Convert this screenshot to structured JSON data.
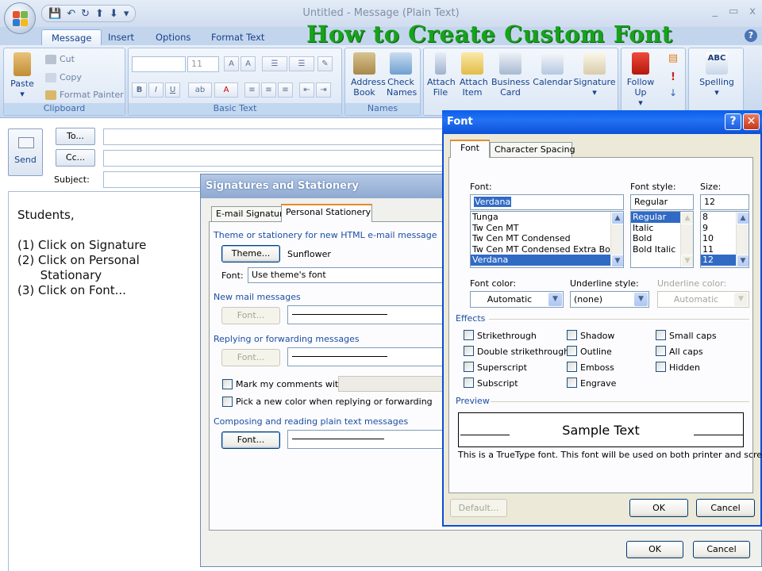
{
  "window": {
    "title": "Untitled - Message (Plain Text)",
    "controls": [
      "_",
      "▭",
      "x"
    ],
    "quick_access": [
      "💾",
      "↶",
      "↻",
      "⬆",
      "⬇",
      "▾"
    ]
  },
  "overlay_title": "How to Create Custom Font",
  "ribbon": {
    "tabs": [
      "Message",
      "Insert",
      "Options",
      "Format Text"
    ],
    "clipboard": {
      "paste": "Paste",
      "cut": "Cut",
      "copy": "Copy",
      "format_painter": "Format Painter",
      "label": "Clipboard"
    },
    "basic_text": {
      "font_size": "11",
      "label": "Basic Text"
    },
    "names": {
      "address_book": "Address Book",
      "check_names": "Check Names",
      "label": "Names"
    },
    "include": {
      "attach_file": "Attach File",
      "attach_item": "Attach Item",
      "business_card": "Business Card",
      "calendar": "Calendar",
      "signature": "Signature"
    },
    "follow_up": "Follow Up",
    "spelling": "Spelling"
  },
  "mail": {
    "send": "Send",
    "to": "To...",
    "cc": "Cc...",
    "subject": "Subject:",
    "body": "Students,\n\n(1) Click on Signature\n(2) Click on Personal\n      Stationary\n(3) Click on Font..."
  },
  "sig_dialog": {
    "title": "Signatures and Stationery",
    "tabs": [
      "E-mail Signature",
      "Personal Stationery"
    ],
    "theme_section": "Theme or stationery for new HTML e-mail message",
    "theme_button": "Theme...",
    "theme_value": "Sunflower",
    "font_label": "Font:",
    "font_value": "Use theme's font",
    "new_mail": "New mail messages",
    "font_button": "Font...",
    "replying": "Replying or forwarding messages",
    "mark_comments": "Mark my comments with:",
    "pick_color": "Pick a new color when replying or forwarding",
    "plain_text": "Composing and reading plain text messages",
    "font_button_active": "Font...",
    "ok": "OK",
    "cancel": "Cancel"
  },
  "font_dialog": {
    "title": "Font",
    "tabs": [
      "Font",
      "Character Spacing"
    ],
    "font_label": "Font:",
    "font_value": "Verdana",
    "font_list": [
      "Tunga",
      "Tw Cen MT",
      "Tw Cen MT Condensed",
      "Tw Cen MT Condensed Extra Bold",
      "Verdana"
    ],
    "style_label": "Font style:",
    "style_value": "Regular",
    "style_list": [
      "Regular",
      "Italic",
      "Bold",
      "Bold Italic"
    ],
    "size_label": "Size:",
    "size_value": "12",
    "size_list": [
      "8",
      "9",
      "10",
      "11",
      "12"
    ],
    "font_color_label": "Font color:",
    "font_color_value": "Automatic",
    "underline_style_label": "Underline style:",
    "underline_style_value": "(none)",
    "underline_color_label": "Underline color:",
    "underline_color_value": "Automatic",
    "effects_label": "Effects",
    "effects": [
      "Strikethrough",
      "Double strikethrough",
      "Superscript",
      "Subscript",
      "Shadow",
      "Outline",
      "Emboss",
      "Engrave",
      "Small caps",
      "All caps",
      "Hidden"
    ],
    "preview_label": "Preview",
    "preview_text": "Sample Text",
    "note": "This is a TrueType font. This font will be used on both printer and screen.",
    "default": "Default...",
    "ok": "OK",
    "cancel": "Cancel"
  }
}
